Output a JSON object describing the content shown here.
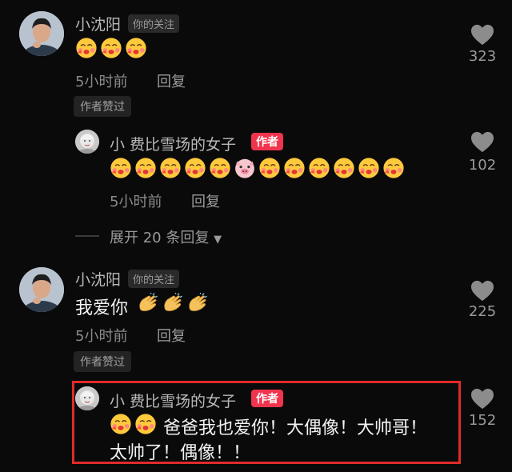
{
  "comments": [
    {
      "user": "小沈阳",
      "tag": "你的关注",
      "emojis": [
        "kiss",
        "kiss",
        "kiss"
      ],
      "time": "5小时前",
      "reply_label": "回复",
      "liked_label": "作者赞过",
      "likes": "323"
    },
    {
      "user": "小 费比雪场的女子",
      "tag": "作者",
      "emojis": [
        "kiss",
        "kiss",
        "kiss",
        "kiss",
        "kiss",
        "pig",
        "kiss",
        "kiss",
        "kiss",
        "kiss",
        "kiss",
        "kiss"
      ],
      "time": "5小时前",
      "reply_label": "回复",
      "likes": "102"
    },
    {
      "user": "小沈阳",
      "tag": "你的关注",
      "text": "我爱你",
      "emojis": [
        "clap",
        "clap",
        "clap"
      ],
      "time": "5小时前",
      "reply_label": "回复",
      "liked_label": "作者赞过",
      "likes": "225"
    },
    {
      "user": "小 费比雪场的女子",
      "tag": "作者",
      "emojis": [
        "kiss",
        "kiss"
      ],
      "text_line1": "爸爸我也爱你！大偶像！大帅哥！",
      "text_line2": "太帅了！偶像！！",
      "likes": "152"
    }
  ],
  "expand_replies": "展开 20 条回复",
  "colors": {
    "author_tag": "#f0344e",
    "highlight_border": "#e02a2a"
  }
}
